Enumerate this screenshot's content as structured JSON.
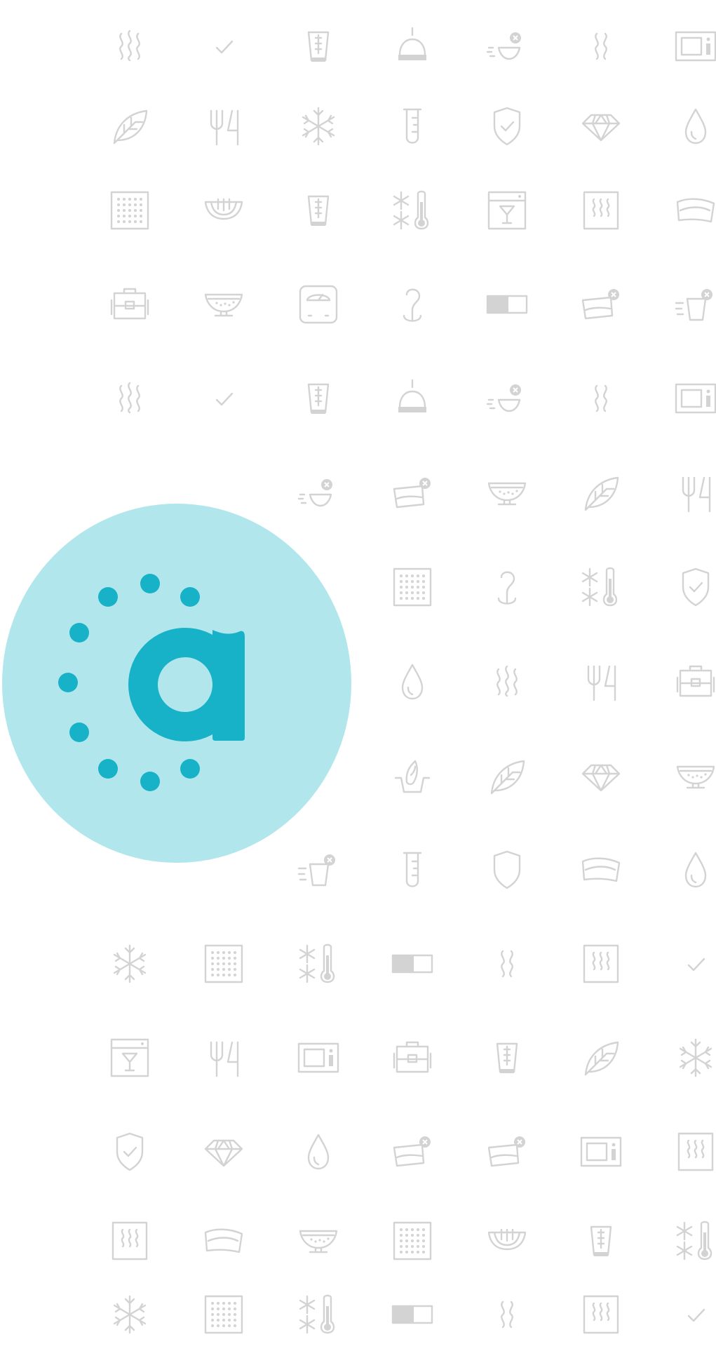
{
  "colors": {
    "background": "#ffffff",
    "icon_stroke": "#d3d3d3",
    "badge_background": "#b1e7ec",
    "brand_accent": "#17b2c7"
  },
  "brand_badge": {
    "letter": "a",
    "icon": "brand-logo-a-with-dots"
  },
  "icon_grid": [
    [
      "steam-icon",
      "check-icon",
      "cup-icon",
      "cloche-icon",
      "wash-bowl-icon",
      "heat-waves-icon",
      "microwave-icon"
    ],
    [
      "leaf-icon",
      "fork-knife-icon",
      "snowflake-icon",
      "test-tube-icon",
      "shield-check-icon",
      "diamond-icon",
      "drop-icon"
    ],
    [
      "grid-dots-icon",
      "bowl-icon",
      "cup-icon",
      "snow-thermometer-icon",
      "oven-glass-icon",
      "radiator-icon",
      "napkin-icon"
    ],
    [
      "bag-icon",
      "sieve-bowl-icon",
      "scale-icon",
      "hook-icon",
      "toggle-icon",
      "tray-cancel-icon",
      "pour-cancel-icon"
    ],
    [
      "steam-icon",
      "check-icon",
      "cup-icon",
      "cloche-icon",
      "wash-bowl-icon",
      "heat-waves-icon",
      "microwave-icon"
    ],
    [
      "",
      "",
      "wash-bowl-icon",
      "tray-cancel-icon",
      "sieve-bowl-icon",
      "leaf-icon",
      "fork-knife-icon"
    ],
    [
      "",
      "",
      "",
      "grid-dots-icon",
      "hook-icon",
      "snow-thermometer-icon",
      "shield-check-icon"
    ],
    [
      "",
      "",
      "",
      "drop-icon",
      "steam-icon",
      "fork-knife-icon",
      "bag-icon"
    ],
    [
      "",
      "",
      "",
      "hand-wash-icon",
      "leaf-icon",
      "diamond-icon",
      "sieve-bowl-icon"
    ],
    [
      "",
      "",
      "pour-cancel-icon",
      "test-tube-icon",
      "shield-icon",
      "napkin-icon",
      "drop-icon"
    ],
    [
      "snowflake-icon",
      "grid-dots-icon",
      "snow-thermometer-icon",
      "toggle-icon",
      "heat-waves-icon",
      "radiator-icon",
      "check-icon"
    ],
    [
      "oven-glass-icon",
      "fork-knife-icon",
      "microwave-icon",
      "bag-icon",
      "cup-icon",
      "leaf-icon",
      "snowflake-icon"
    ],
    [
      "shield-check-icon",
      "diamond-icon",
      "drop-icon",
      "tray-cancel-icon",
      "tray-cancel-icon",
      "microwave-icon",
      "radiator-icon"
    ],
    [
      "radiator-icon",
      "napkin-icon",
      "sieve-bowl-icon",
      "grid-dots-icon",
      "bowl-icon",
      "cup-icon",
      "snow-thermometer-icon"
    ],
    [
      "snowflake-icon",
      "grid-dots-icon",
      "snow-thermometer-icon",
      "toggle-icon",
      "heat-waves-icon",
      "radiator-icon",
      "check-icon"
    ]
  ]
}
